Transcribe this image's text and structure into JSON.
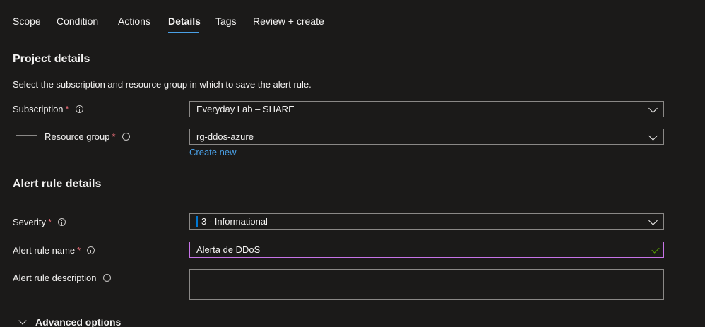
{
  "tabs": [
    {
      "label": "Scope"
    },
    {
      "label": "Condition"
    },
    {
      "label": "Actions"
    },
    {
      "label": "Details"
    },
    {
      "label": "Tags"
    },
    {
      "label": "Review + create"
    }
  ],
  "active_tab": "Details",
  "project": {
    "title": "Project details",
    "description": "Select the subscription and resource group in which to save the alert rule.",
    "subscription_label": "Subscription",
    "subscription_value": "Everyday Lab – SHARE",
    "resource_group_label": "Resource group",
    "resource_group_value": "rg-ddos-azure",
    "create_new": "Create new"
  },
  "alert": {
    "title": "Alert rule details",
    "severity_label": "Severity",
    "severity_value": "3 - Informational",
    "name_label": "Alert rule name",
    "name_value": "Alerta de DDoS",
    "description_label": "Alert rule description",
    "description_value": ""
  },
  "advanced": {
    "label": "Advanced options"
  },
  "required_marker": "*",
  "colors": {
    "accent": "#4aa0e6",
    "required": "#f1707b",
    "focus": "#c774e8",
    "valid": "#57a300",
    "severity": "#0078d4"
  }
}
